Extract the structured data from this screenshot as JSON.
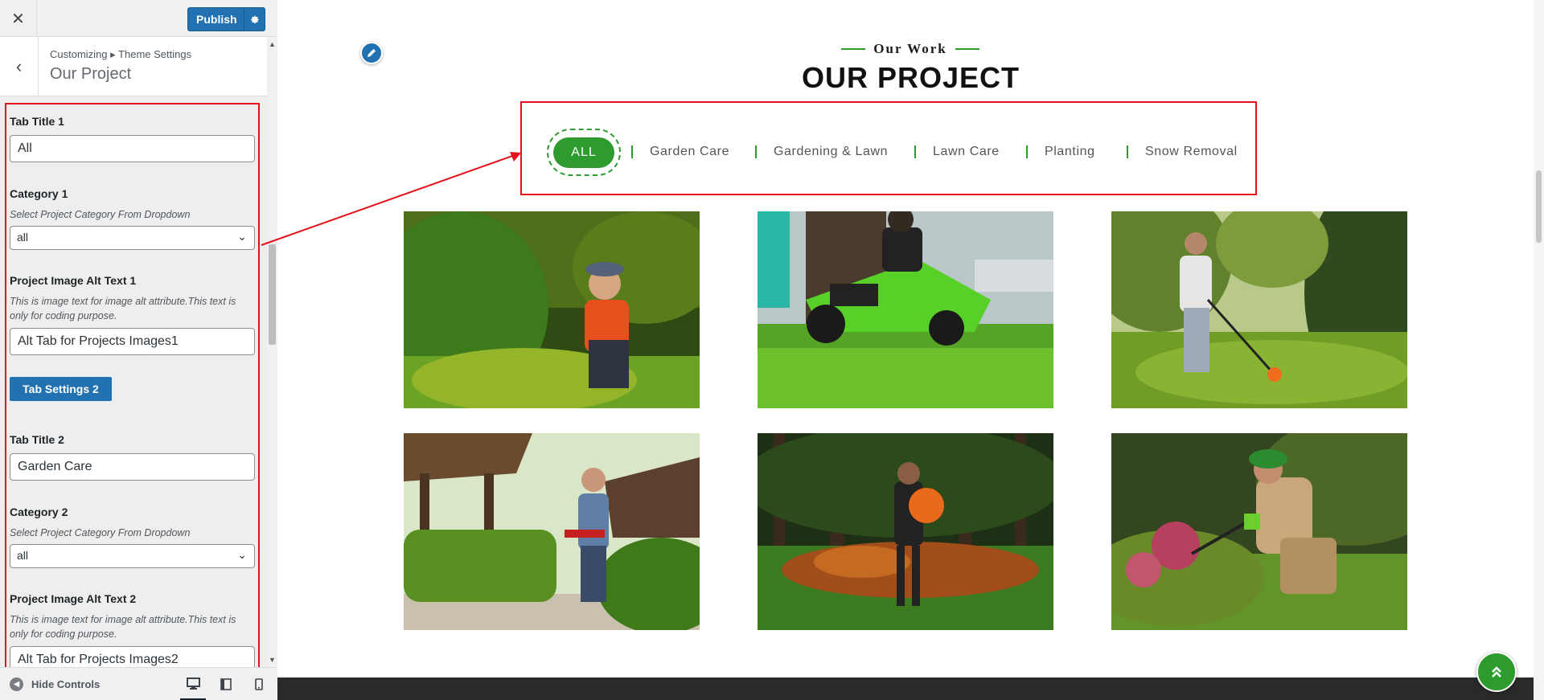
{
  "topbar": {
    "close_glyph": "✕",
    "publish_label": "Publish",
    "gear_icon": "gear-icon"
  },
  "section": {
    "breadcrumb": "Customizing ▸ Theme Settings",
    "title": "Our Project",
    "back_glyph": "‹"
  },
  "controls": {
    "tab1": {
      "title_label": "Tab Title 1",
      "title_value": "All",
      "category_label": "Category 1",
      "category_desc": "Select Project Category From Dropdown",
      "category_value": "all",
      "alt_label": "Project Image Alt Text 1",
      "alt_desc": "This is image text for image alt attribute.This text is only for coding purpose.",
      "alt_value": "Alt Tab for Projects Images1"
    },
    "tab_settings_2_label": "Tab Settings 2",
    "tab2": {
      "title_label": "Tab Title 2",
      "title_value": "Garden Care",
      "category_label": "Category 2",
      "category_desc": "Select Project Category From Dropdown",
      "category_value": "all",
      "alt_label": "Project Image Alt Text 2",
      "alt_desc": "This is image text for image alt attribute.This text is only for coding purpose.",
      "alt_value": "Alt Tab for Projects Images2"
    }
  },
  "footer": {
    "hide_controls_label": "Hide Controls",
    "devices": [
      "desktop-icon",
      "tablet-icon",
      "mobile-icon"
    ]
  },
  "preview": {
    "kicker": "Our Work",
    "heading": "OUR PROJECT",
    "tabs": [
      "ALL",
      "Garden Care",
      "Gardening & Lawn",
      "Lawn Care",
      "Planting",
      "Snow Removal"
    ],
    "active_tab": "ALL",
    "accent_color": "#2e9b2e",
    "highlight_color": "#e3111b",
    "images": [
      "gardener-trimming-hedge-photo",
      "riding-lawn-mower-photo",
      "man-with-string-trimmer-photo",
      "man-with-hedge-trimmer-photo",
      "leaf-blower-worker-photo",
      "gardener-pruning-bushes-photo"
    ]
  }
}
